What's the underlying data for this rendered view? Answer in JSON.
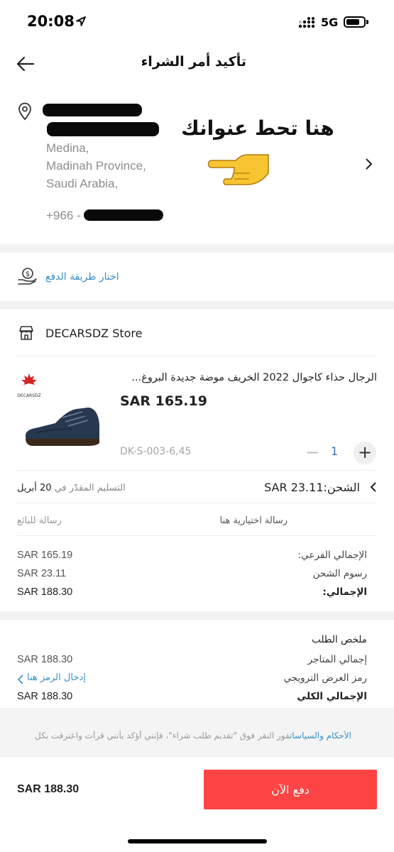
{
  "status_bar": {
    "time": "20:08",
    "network": "5G",
    "battery_level": 0.8
  },
  "header": {
    "title": "تأكيد أمر الشراء"
  },
  "address": {
    "lines": [
      "Medina,",
      "Madinah Province,",
      "Saudi Arabia,"
    ],
    "phone_prefix": "+966 -",
    "hint_text": "هنا تحط عنوانك"
  },
  "payment": {
    "label": "اختار طريقة الدفع"
  },
  "store": {
    "name": "DECARSDZ Store",
    "product": {
      "title": "الرجال حذاء كاجوال 2022 الخريف موضة جديدة البروغ...",
      "price": "SAR 165.19",
      "sku": "DK-S-003-6,45",
      "quantity": "1",
      "brand_logo_text": "DECARSDZ"
    },
    "shipping": {
      "label": "الشحن:SAR 23.11",
      "delivery_prefix": "التسليم المقدّر في",
      "delivery_date": "20 أبريل"
    },
    "message": {
      "label": "رسالة للبائع",
      "placeholder": "رسالة اختيارية هنا"
    },
    "rows": [
      {
        "label": "الإجمالي الفرعي:",
        "value": "SAR 165.19"
      },
      {
        "label": "رسوم الشحن",
        "value": "SAR 23.11"
      },
      {
        "label": "الإجمالي:",
        "value": "SAR 188.30"
      }
    ]
  },
  "summary": {
    "title": "ملخص الطلب",
    "merchant_total_label": "إجمالي المتاجر",
    "merchant_total_value": "SAR 188.30",
    "promo_label": "رمز العرض الترويجي",
    "promo_link": "إدخال الرمز هنا",
    "grand_total_label": "الإجمالي الكلي",
    "grand_total_value": "SAR 188.30"
  },
  "terms": {
    "link": "الأحكام والسياسات",
    "text": "فور النقر فوق \"تقديم طلب شراء\"، فإنني أؤكد بأنني قرأت واعترفت بكل"
  },
  "footer": {
    "total": "SAR 188.30",
    "pay_button": "دفع الآن"
  },
  "colors": {
    "accent_red": "#fd4444",
    "link_blue": "#3a8fc8"
  }
}
